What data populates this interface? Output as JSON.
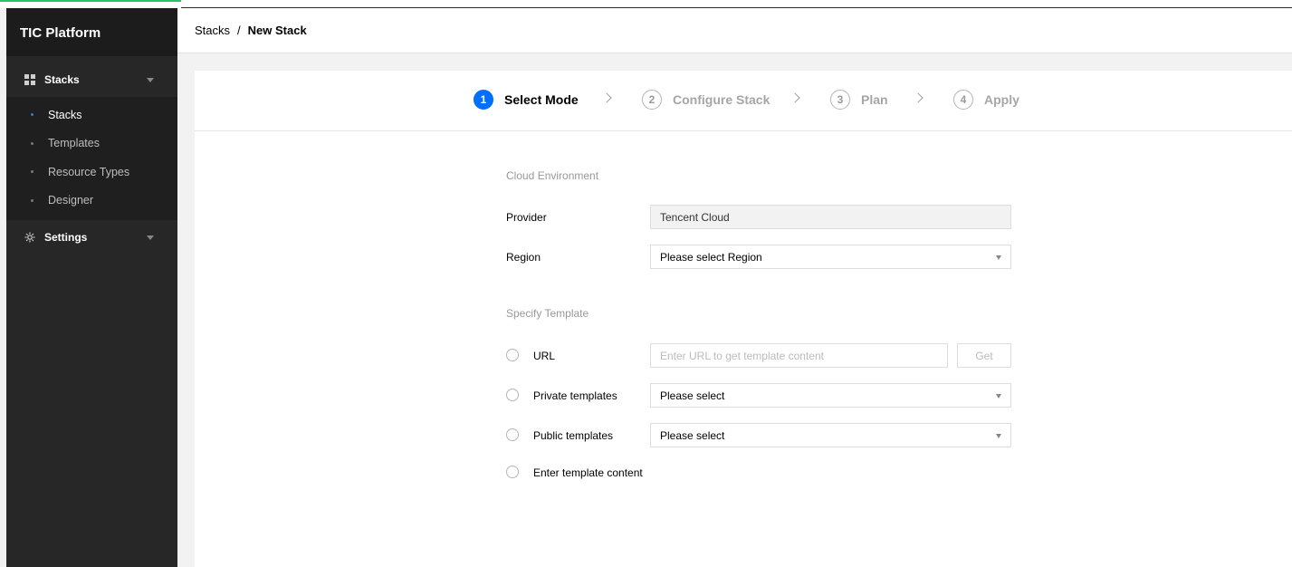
{
  "sidebar": {
    "brand": "TIC Platform",
    "groups": [
      {
        "label": "Stacks",
        "icon": "grid-icon"
      },
      {
        "label": "Settings",
        "icon": "gear-icon"
      }
    ],
    "stack_items": [
      {
        "label": "Stacks",
        "active": true
      },
      {
        "label": "Templates",
        "active": false
      },
      {
        "label": "Resource Types",
        "active": false
      },
      {
        "label": "Designer",
        "active": false
      }
    ]
  },
  "header": {
    "breadcrumb_root": "Stacks",
    "separator": "/",
    "breadcrumb_current": "New Stack"
  },
  "steps": [
    {
      "num": "1",
      "label": "Select Mode",
      "active": true
    },
    {
      "num": "2",
      "label": "Configure Stack",
      "active": false
    },
    {
      "num": "3",
      "label": "Plan",
      "active": false
    },
    {
      "num": "4",
      "label": "Apply",
      "active": false
    }
  ],
  "cloud_env": {
    "title": "Cloud Environment",
    "provider_label": "Provider",
    "provider_value": "Tencent Cloud",
    "region_label": "Region",
    "region_value": "Please select Region"
  },
  "template": {
    "title": "Specify Template",
    "url_label": "URL",
    "url_placeholder": "Enter URL to get template content",
    "get_button": "Get",
    "private_label": "Private templates",
    "private_value": "Please select",
    "public_label": "Public templates",
    "public_value": "Please select",
    "content_label": "Enter template content"
  },
  "colors": {
    "accent": "#006eff",
    "sidebar_bg": "#272727",
    "brand_bg": "#1c1c1c",
    "top_accent": "#27c566"
  }
}
